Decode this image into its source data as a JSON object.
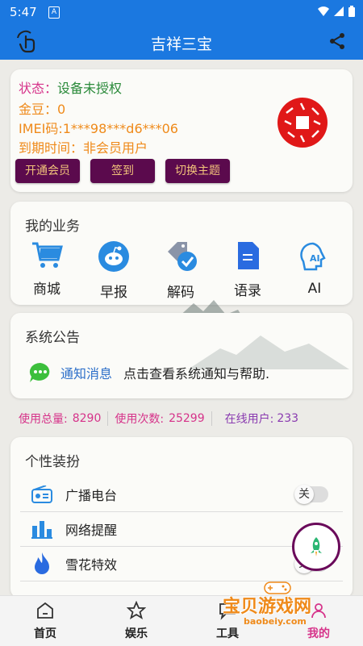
{
  "status_bar": {
    "time": "5:47",
    "badge": "A"
  },
  "app_bar": {
    "title": "吉祥三宝"
  },
  "status_card": {
    "status_label": "状态：",
    "status_value": "设备未授权",
    "gold": "金豆：0",
    "imei": "IMEI码:1***98***d6***06",
    "expire_label": "到期时间：",
    "expire_value": "非会员用户",
    "buttons": [
      "开通会员",
      "签到",
      "切换主题"
    ]
  },
  "business": {
    "title": "我的业务",
    "items": [
      {
        "label": "商城",
        "icon": "cart-icon"
      },
      {
        "label": "早报",
        "icon": "reddit-icon"
      },
      {
        "label": "解码",
        "icon": "tag-check-icon"
      },
      {
        "label": "语录",
        "icon": "document-icon"
      },
      {
        "label": "AI",
        "icon": "ai-head-icon"
      }
    ]
  },
  "notice": {
    "title": "系统公告",
    "link": "通知消息",
    "text": "点击查看系统通知与帮助."
  },
  "stats": {
    "total_label": "使用总量:",
    "total_value": "8290",
    "count_label": "使用次数:",
    "count_value": "25299",
    "online_label": "在线用户:",
    "online_value": "233"
  },
  "decor": {
    "title": "个性装扮",
    "rows": [
      {
        "label": "广播电台",
        "toggle": "关",
        "icon": "radio-icon"
      },
      {
        "label": "网络提醒",
        "toggle": "",
        "icon": "bar-chart-icon"
      },
      {
        "label": "雪花特效",
        "toggle": "关",
        "icon": "flame-icon"
      }
    ]
  },
  "nav": {
    "items": [
      {
        "label": "首页",
        "icon": "home-icon"
      },
      {
        "label": "娱乐",
        "icon": "star-icon"
      },
      {
        "label": "工具",
        "icon": "chat-icon"
      },
      {
        "label": "我的",
        "icon": "user-icon"
      }
    ]
  },
  "watermark": {
    "text": "宝贝游戏网",
    "url": "baobeiy.com"
  },
  "colors": {
    "primary": "#1b78e0",
    "button_bg": "#5b0a4d",
    "button_text": "#f2c37b",
    "status_pink": "#d6338a",
    "status_green": "#2a8a3a",
    "orange": "#ef8a1a",
    "link_blue": "#2d6fc9"
  }
}
